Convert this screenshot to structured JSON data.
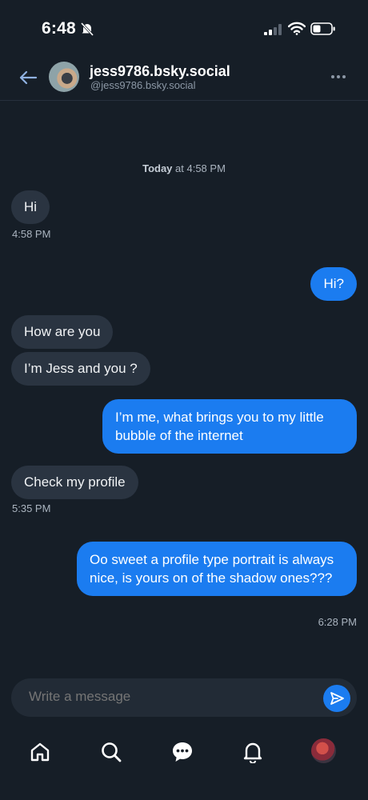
{
  "status_bar": {
    "time": "6:48"
  },
  "header": {
    "display_name": "jess9786.bsky.social",
    "handle": "@jess9786.bsky.social"
  },
  "chat": {
    "day_label_bold": "Today",
    "day_label_rest": " at 4:58 PM",
    "messages": [
      {
        "dir": "in",
        "text": "Hi",
        "time": "4:58 PM"
      },
      {
        "dir": "out",
        "text": "Hi?"
      },
      {
        "dir": "in",
        "text": "How are you"
      },
      {
        "dir": "in",
        "text": "I’m Jess and you ?"
      },
      {
        "dir": "out",
        "text": "I’m me, what brings you to my little bubble of the internet"
      },
      {
        "dir": "in",
        "text": "Check my profile",
        "time": "5:35 PM"
      },
      {
        "dir": "out",
        "text": "Oo sweet a profile type portrait is always nice, is yours on of the shadow ones???",
        "time": "6:28 PM"
      }
    ]
  },
  "composer": {
    "placeholder": "Write a message"
  },
  "tab_bar": {
    "items": [
      "home-icon",
      "search-icon",
      "chat-icon",
      "bell-icon",
      "profile-avatar"
    ]
  },
  "colors": {
    "background": "#161e27",
    "outgoing": "#1b7cf0",
    "incoming": "#2a3441"
  }
}
